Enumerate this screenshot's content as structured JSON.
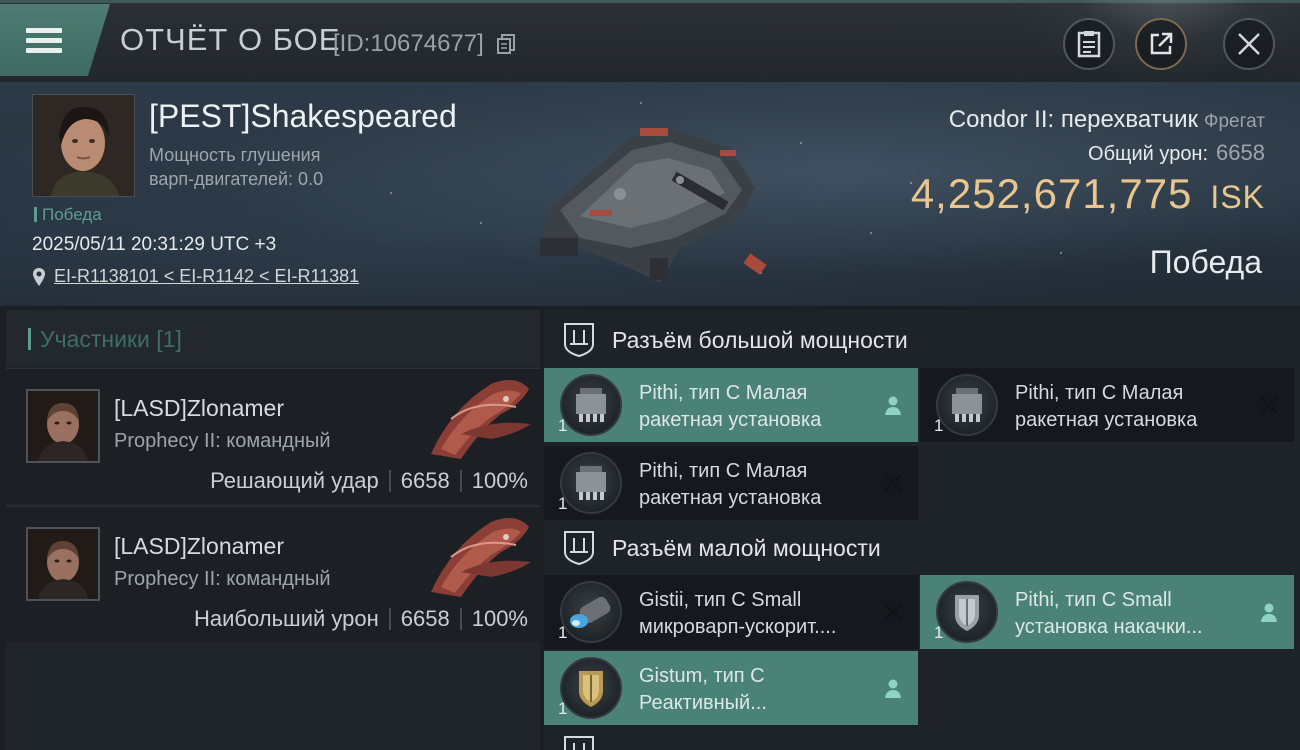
{
  "header": {
    "title": "ОТЧЁТ О БОЕ",
    "id": "[ID:10674677]",
    "buttons": {
      "clipboard": "clipboard-icon",
      "share": "share-icon",
      "close": "close-icon"
    }
  },
  "victim": {
    "name": "[PEST]Shakespeared",
    "jam_label_line1": "Мощность глушения",
    "jam_label_line2": "варп-двигателей: 0.0",
    "result_small": "Победа",
    "datetime": "2025/05/11 20:31:29 UTC +3",
    "location": "EI-R1138101 < EI-R1142 < EI-R11381",
    "ship_name": "Condor II: перехватчик",
    "ship_class": "Фрегат",
    "total_damage_label": "Общий урон:",
    "total_damage_value": "6658",
    "isk_value": "4,252,671,775",
    "isk_unit": "ISK",
    "result": "Победа"
  },
  "participants": {
    "header": "Участники [1]",
    "items": [
      {
        "name": "[LASD]Zlonamer",
        "ship": "Prophecy II: командный",
        "role": "Решающий удар",
        "damage": "6658",
        "percent": "100%"
      },
      {
        "name": "[LASD]Zlonamer",
        "ship": "Prophecy II: командный",
        "role": "Наибольший урон",
        "damage": "6658",
        "percent": "100%"
      }
    ]
  },
  "fitting": {
    "high_slots": {
      "title": "Разъём большой мощности",
      "modules": [
        {
          "line1": "Pithi, тип C Малая",
          "line2": "ракетная установка",
          "qty": "1",
          "status": "dropped",
          "icon": "missile-launcher-icon"
        },
        {
          "line1": "Pithi, тип C Малая",
          "line2": "ракетная установка",
          "qty": "1",
          "status": "destroyed",
          "icon": "missile-launcher-icon"
        },
        {
          "line1": "Pithi, тип C Малая",
          "line2": "ракетная установка",
          "qty": "1",
          "status": "destroyed",
          "icon": "missile-launcher-icon"
        }
      ]
    },
    "mid_slots": {
      "title": "Разъём малой мощности",
      "modules": [
        {
          "line1": "Gistii, тип C Small",
          "line2": "микроварп-ускорит....",
          "qty": "1",
          "status": "destroyed",
          "icon": "microwarpdrive-icon"
        },
        {
          "line1": "Pithi, тип C Small",
          "line2": "установка накачки...",
          "qty": "1",
          "status": "dropped",
          "icon": "shield-booster-icon"
        },
        {
          "line1": "Gistum, тип C",
          "line2": "Реактивный...",
          "qty": "1",
          "status": "dropped",
          "icon": "shield-hardener-icon"
        }
      ]
    }
  },
  "colors": {
    "accent": "#4b8277",
    "isk": "#e8c68e",
    "victory": "#5d9d8f"
  }
}
